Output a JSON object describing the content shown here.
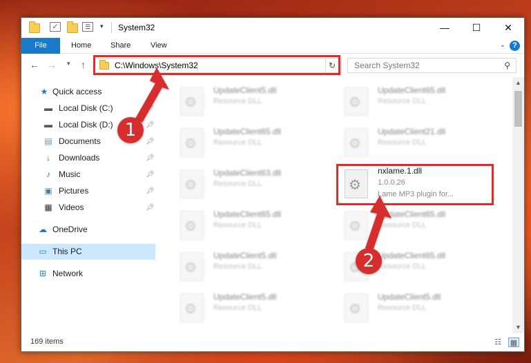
{
  "window": {
    "title": "System32"
  },
  "titlebar": {
    "minimize_icon": "minimize-icon",
    "maximize_icon": "maximize-icon",
    "close_icon": "close-icon"
  },
  "ribbon": {
    "tabs": [
      {
        "label": "File"
      },
      {
        "label": "Home"
      },
      {
        "label": "Share"
      },
      {
        "label": "View"
      }
    ],
    "help_label": "?"
  },
  "address_bar": {
    "path": "C:\\Windows\\System32"
  },
  "search": {
    "placeholder": "Search System32"
  },
  "sidebar": {
    "items": [
      {
        "label": "Quick access",
        "icon": "star-icon"
      },
      {
        "label": "Local Disk (C:)",
        "icon": "drive-icon",
        "pinned": true
      },
      {
        "label": "Local Disk (D:)",
        "icon": "drive-icon",
        "pinned": true
      },
      {
        "label": "Documents",
        "icon": "documents-icon",
        "pinned": true
      },
      {
        "label": "Downloads",
        "icon": "downloads-icon",
        "pinned": true
      },
      {
        "label": "Music",
        "icon": "music-icon",
        "pinned": true
      },
      {
        "label": "Pictures",
        "icon": "pictures-icon",
        "pinned": true
      },
      {
        "label": "Videos",
        "icon": "videos-icon",
        "pinned": true
      },
      {
        "label": "OneDrive",
        "icon": "cloud-icon"
      },
      {
        "label": "This PC",
        "icon": "computer-icon",
        "selected": true
      },
      {
        "label": "Network",
        "icon": "network-icon"
      }
    ]
  },
  "files": {
    "left_column": [
      {
        "name": "UpdateClient5.dll",
        "desc": "Resource DLL"
      },
      {
        "name": "UpdateClient65.dll",
        "desc": "Resource DLL"
      },
      {
        "name": "UpdateClient63.dll",
        "desc": "Resource DLL"
      },
      {
        "name": "UpdateClient65.dll",
        "desc": "Resource DLL"
      },
      {
        "name": "UpdateClient5.dll",
        "desc": "Resource DLL"
      },
      {
        "name": "UpdateClient5.dll",
        "desc": "Resource DLL"
      }
    ],
    "right_column": [
      {
        "name": "UpdateClient65.dll",
        "desc": "Resource DLL"
      },
      {
        "name": "UpdateClient21.dll",
        "desc": "Resource DLL"
      },
      {
        "name": "UpdateClient65.dll",
        "desc": "Resource DLL"
      },
      {
        "name": "UpdateClient65.dll",
        "desc": "Resource DLL"
      },
      {
        "name": "UpdateClient5.dll",
        "desc": "Resource DLL"
      }
    ],
    "highlighted": {
      "name": "nxlame.1.dll",
      "version": "1.0.0.26",
      "desc": "Lame MP3 plugin for..."
    }
  },
  "status": {
    "item_count": "169 items"
  },
  "annotations": {
    "callout_1": "1",
    "callout_2": "2",
    "highlight_color": "#e02b2b",
    "callout_color": "#d62e2e"
  },
  "colors": {
    "file_tab": "#1979ca",
    "selected_nav": "#cce8ff"
  }
}
